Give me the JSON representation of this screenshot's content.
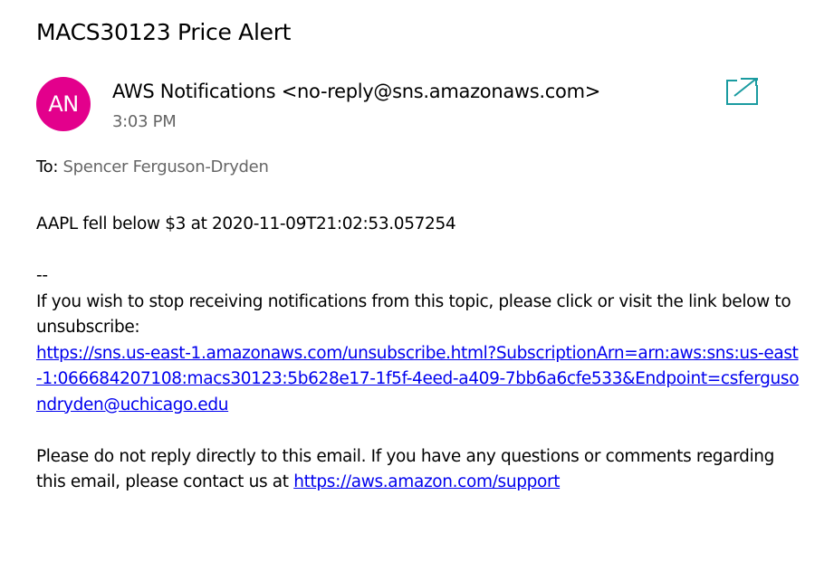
{
  "email": {
    "subject": "MACS30123 Price Alert",
    "avatar_initials": "AN",
    "avatar_color": "#e3008c",
    "sender": "AWS Notifications <no-reply@sns.amazonaws.com>",
    "time": "3:03 PM",
    "to_label": "To:",
    "to_name": "Spencer Ferguson-Dryden",
    "popout_icon": "open-in-new-window-icon",
    "accent_color": "#1a9ba0"
  },
  "body": {
    "alert_line": "AAPL fell below $3 at 2020-11-09T21:02:53.057254",
    "separator": "--",
    "unsubscribe_text": "If you wish to stop receiving notifications from this topic, please click or visit the link below to unsubscribe:",
    "unsubscribe_url": "https://sns.us-east-1.amazonaws.com/unsubscribe.html?SubscriptionArn=arn:aws:sns:us-east-1:066684207108:macs30123:5b628e17-1f5f-4eed-a409-7bb6a6cfe533&Endpoint=csfergusondryden@uchicago.edu",
    "footer_text": "Please do not reply directly to this email. If you have any questions or comments regarding this email, please contact us at",
    "support_url": "https://aws.amazon.com/support",
    "link_color": "#0000ee"
  }
}
